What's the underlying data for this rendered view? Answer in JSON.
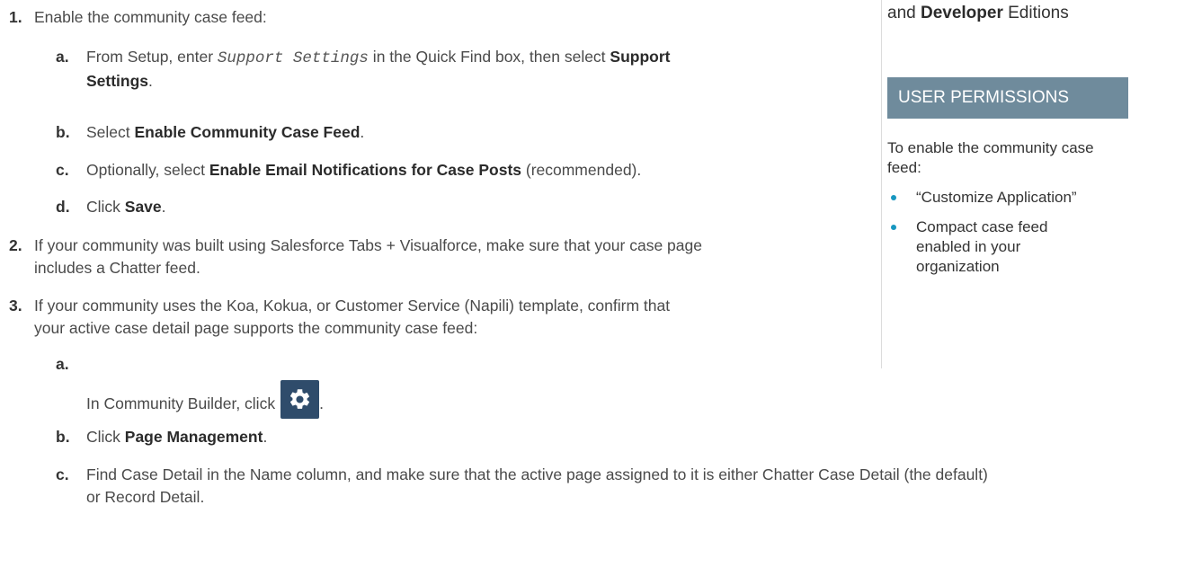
{
  "steps": [
    {
      "num": "1.",
      "text": "Enable the community case feed:"
    },
    {
      "num": "2.",
      "line1": "If your community was built using Salesforce Tabs + Visualforce, make sure that your case page",
      "line2": "includes a Chatter feed."
    },
    {
      "num": "3.",
      "line1": "If your community uses the Koa, Kokua, or Customer Service (Napili) template, confirm that",
      "line2": "your active case detail page supports the community case feed:"
    }
  ],
  "step1_sub": {
    "a": {
      "letter": "a.",
      "pre": "From Setup, enter ",
      "code": "Support Settings",
      "mid": " in the Quick Find box, then select ",
      "bold1": "Support",
      "bold2": "Settings",
      "post": "."
    },
    "b": {
      "letter": "b.",
      "pre": "Select ",
      "bold": "Enable Community Case Feed",
      "post": "."
    },
    "c": {
      "letter": "c.",
      "pre": "Optionally, select ",
      "bold": "Enable Email Notifications for Case Posts",
      "post": " (recommended)."
    },
    "d": {
      "letter": "d.",
      "pre": "Click ",
      "bold": "Save",
      "post": "."
    }
  },
  "step3_sub": {
    "a": {
      "letter": "a.",
      "pre": "In Community Builder, click",
      "post": "."
    },
    "b": {
      "letter": "b.",
      "pre": "Click ",
      "bold": "Page Management",
      "post": "."
    },
    "c": {
      "letter": "c.",
      "line1": "Find Case Detail in the Name column, and make sure that the active page assigned to it is either Chatter Case Detail (the default)",
      "line2": "or Record Detail."
    }
  },
  "sidebar": {
    "editions_pre": "and ",
    "editions_bold": "Developer",
    "editions_post": " Editions",
    "permissions_header": "USER PERMISSIONS",
    "permissions_desc": "To enable the community case feed:",
    "bullets": [
      "“Customize Application”",
      "Compact case feed enabled in your organization"
    ]
  },
  "colors": {
    "bullet": "#1797c0",
    "header_bg": "#6f8b9c",
    "gear_bg": "#2f4c6b"
  },
  "icons": {
    "settings": "gear-icon"
  }
}
